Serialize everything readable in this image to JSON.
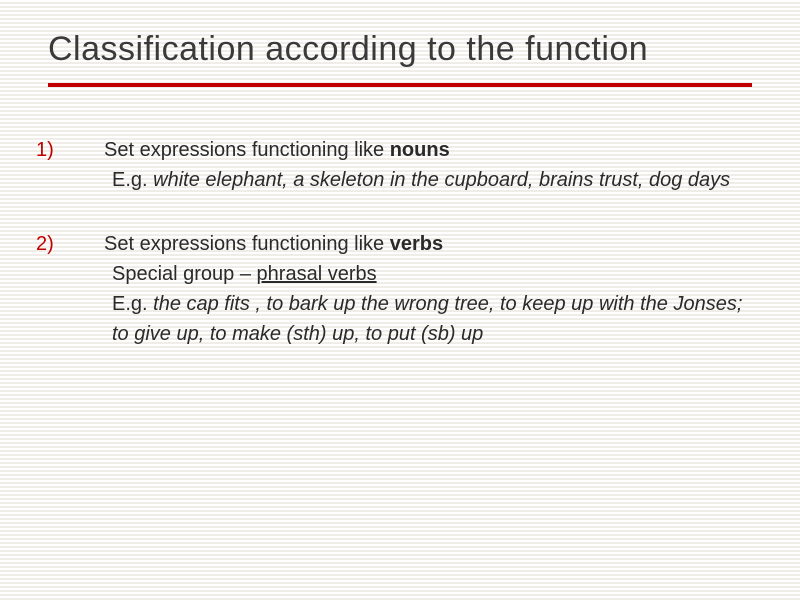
{
  "title": "Classification according to the function",
  "items": [
    {
      "num": "1)",
      "head_pre": "Set expressions functioning  like ",
      "head_bold": "nouns",
      "sub1_pre": "E.g. ",
      "sub1_ital": "white elephant, a skeleton in the cupboard, brains trust, dog days",
      "sub2_pre": "",
      "sub2_under": "",
      "sub3_pre": "",
      "sub3_ital": ""
    },
    {
      "num": "2)",
      "head_pre": "Set expressions functioning like ",
      "head_bold": "verbs",
      "sub1_pre": "Special group – ",
      "sub1_under": "phrasal verbs",
      "sub2_pre": "E.g. ",
      "sub2_ital": "the cap fits , to bark up the wrong tree, to keep up with the Jonses; to give up, to make (sth) up, to put (sb) up",
      "sub3_pre": "",
      "sub3_ital": ""
    }
  ]
}
